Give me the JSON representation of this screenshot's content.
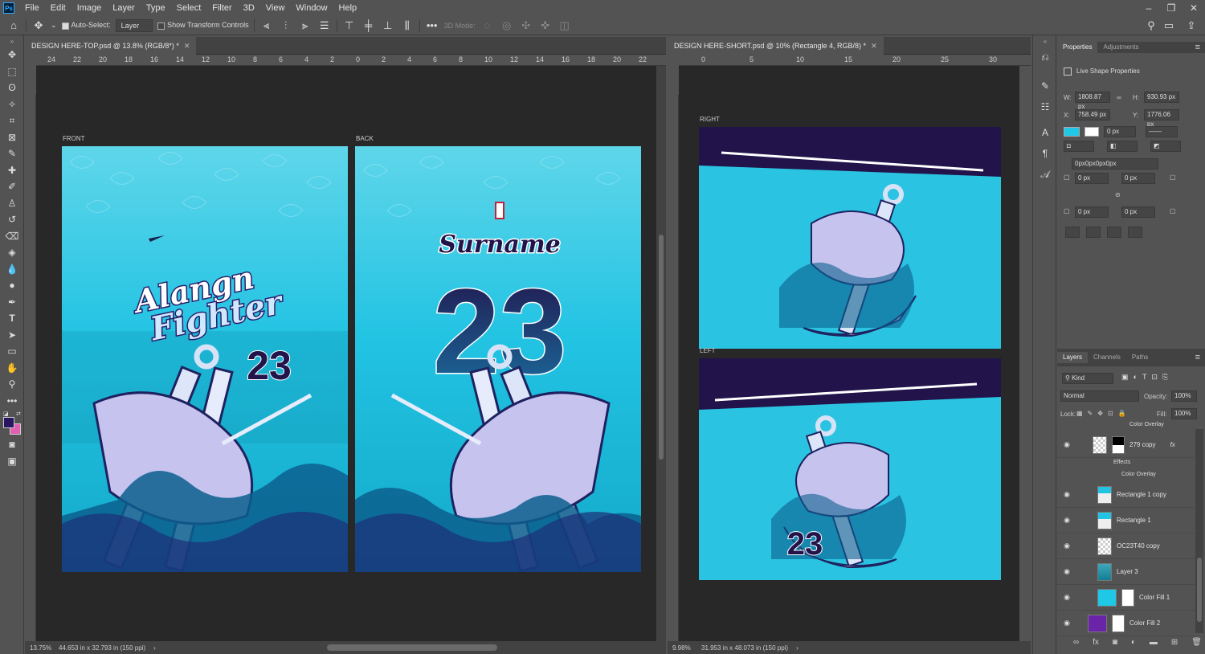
{
  "menu": {
    "logo": "Ps",
    "items": [
      "File",
      "Edit",
      "Image",
      "Layer",
      "Type",
      "Select",
      "Filter",
      "3D",
      "View",
      "Window",
      "Help"
    ]
  },
  "options": {
    "auto_select": "Auto-Select:",
    "auto_select_target": "Layer",
    "show_transform": "Show Transform Controls",
    "mode_3d": "3D Mode:"
  },
  "doc1": {
    "tab": "DESIGN HERE-TOP.psd @ 13.8% (RGB/8*) *",
    "zoom": "13.75%",
    "info": "44.653 in x 32.793 in (150 ppi)",
    "ruler": [
      "24",
      "22",
      "20",
      "18",
      "16",
      "14",
      "12",
      "10",
      "8",
      "6",
      "4",
      "2",
      "0",
      "2",
      "4",
      "6",
      "8",
      "10",
      "12",
      "14",
      "16",
      "18",
      "20",
      "22"
    ],
    "front_label": "FRONT",
    "back_label": "BACK",
    "front_title_1": "Alangn",
    "front_title_2": "Fighter",
    "front_number": "23",
    "back_surname": "Surname",
    "back_number": "23"
  },
  "doc2": {
    "tab": "DESIGN HERE-SHORT.psd @ 10% (Rectangle 4, RGB/8) *",
    "zoom": "9.98%",
    "info": "31.953 in x 48.073 in (150 ppi)",
    "ruler": [
      "0",
      "5",
      "10",
      "15",
      "20",
      "25",
      "30"
    ],
    "right_label": "RIGHT",
    "left_label": "LEFT",
    "left_number": "23"
  },
  "properties": {
    "tab_active": "Properties",
    "tab_other": "Adjustments",
    "section": "Live Shape Properties",
    "w_label": "W:",
    "w": "1808.87 px",
    "h_label": "H:",
    "h": "930.93 px",
    "x_label": "X:",
    "x": "758.49 px",
    "y_label": "Y:",
    "y": "1776.06 px",
    "stroke": "0 px",
    "radius_all": "0px0px0px0px",
    "r1": "0 px",
    "r2": "0 px",
    "r3": "0 px",
    "r4": "0 px"
  },
  "layers_panel": {
    "tabs": [
      "Layers",
      "Channels",
      "Paths"
    ],
    "kind": "Kind",
    "blend": "Normal",
    "opacity_label": "Opacity:",
    "opacity": "100%",
    "lock_label": "Lock:",
    "fill_label": "Fill:",
    "fill": "100%",
    "top_effect": "Color Overlay",
    "rows": [
      {
        "name": "279 copy",
        "fx": "fx"
      },
      {
        "name": "Rectangle 1 copy"
      },
      {
        "name": "Rectangle 1"
      },
      {
        "name": "OC23T40 copy"
      },
      {
        "name": "Layer 3"
      },
      {
        "name": "Color Fill 1"
      },
      {
        "name": "Color Fill 2"
      }
    ],
    "effects_label": "Effects",
    "effect_item": "Color Overlay"
  },
  "colors": {
    "cyan": "#1ec8e6",
    "navy": "#22134a",
    "ui": "#535353",
    "canvas": "#282828",
    "fg_swatch": "#2a1560",
    "bg_swatch": "#e060b0"
  }
}
